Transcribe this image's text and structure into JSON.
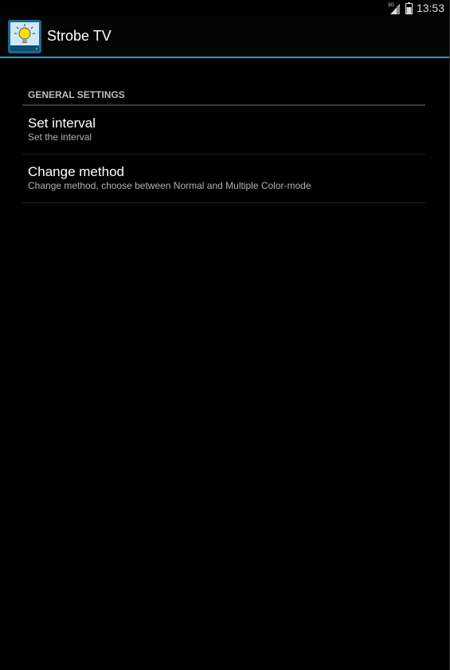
{
  "status_bar": {
    "time": "13:53",
    "network_label": "3G",
    "icons": [
      "signal-3g-icon",
      "battery-icon"
    ]
  },
  "action_bar": {
    "app_icon": "lightbulb-tv-icon",
    "title": "Strobe TV",
    "accent_color": "#2b9bc8"
  },
  "settings": {
    "category": "GENERAL SETTINGS",
    "items": [
      {
        "title": "Set interval",
        "summary": "Set the interval"
      },
      {
        "title": "Change method",
        "summary": "Change method, choose between Normal and Multiple Color-mode"
      }
    ]
  }
}
